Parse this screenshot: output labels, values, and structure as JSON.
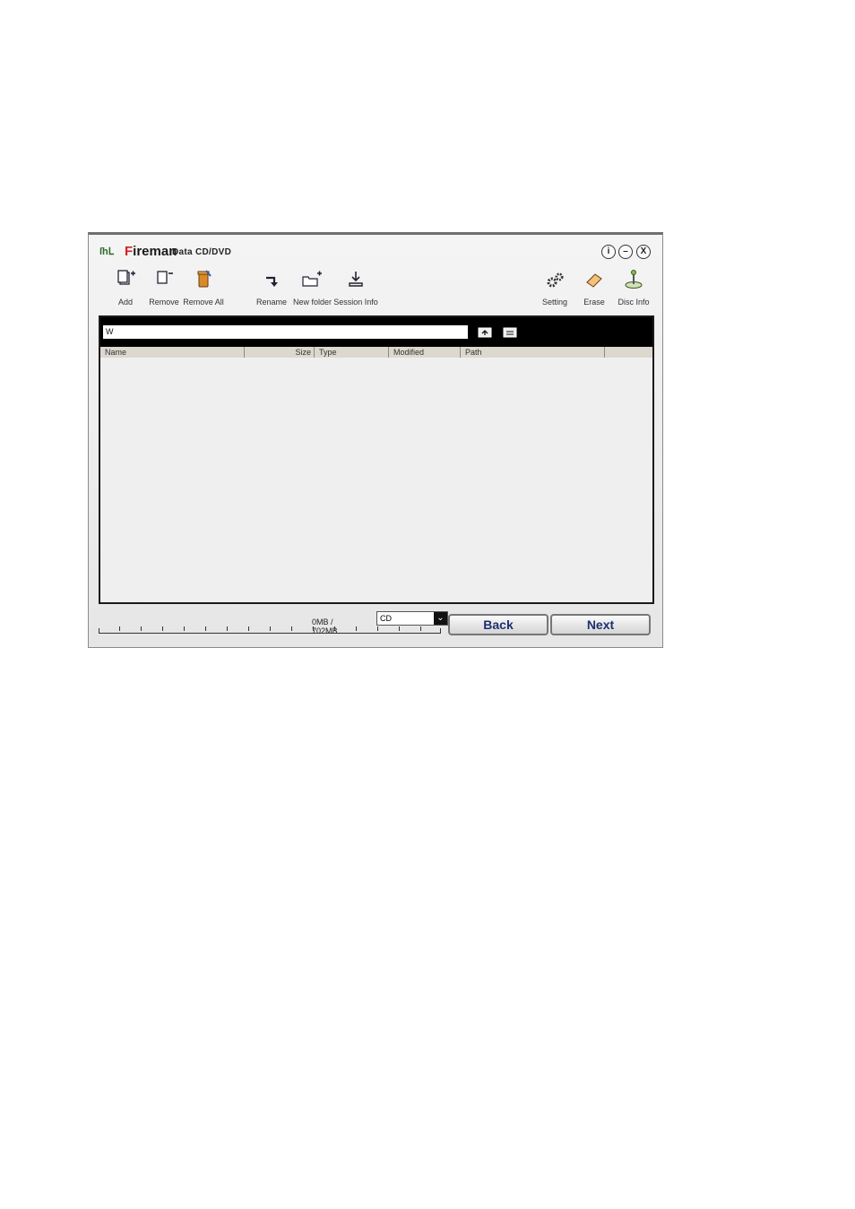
{
  "window": {
    "logo": "ſhᒪ",
    "title_first_letter": "F",
    "title_rest": "ireman",
    "subtitle": "Data CD/DVD",
    "controls": {
      "info": "i",
      "minimize": "–",
      "close": "X"
    }
  },
  "toolbar": {
    "add": "Add",
    "remove": "Remove",
    "remove_all": "Remove All",
    "rename": "Rename",
    "new_folder": "New folder",
    "session_info": "Session Info",
    "setting": "Setting",
    "erase": "Erase",
    "disc_info": "Disc Info"
  },
  "path": {
    "value": "W"
  },
  "table": {
    "columns": [
      "Name",
      "Size",
      "Type",
      "Modified",
      "Path"
    ],
    "rows": []
  },
  "footer": {
    "capacity": "0MB / 702MB",
    "progress": 0,
    "media_type": "CD",
    "back": "Back",
    "next": "Next"
  }
}
